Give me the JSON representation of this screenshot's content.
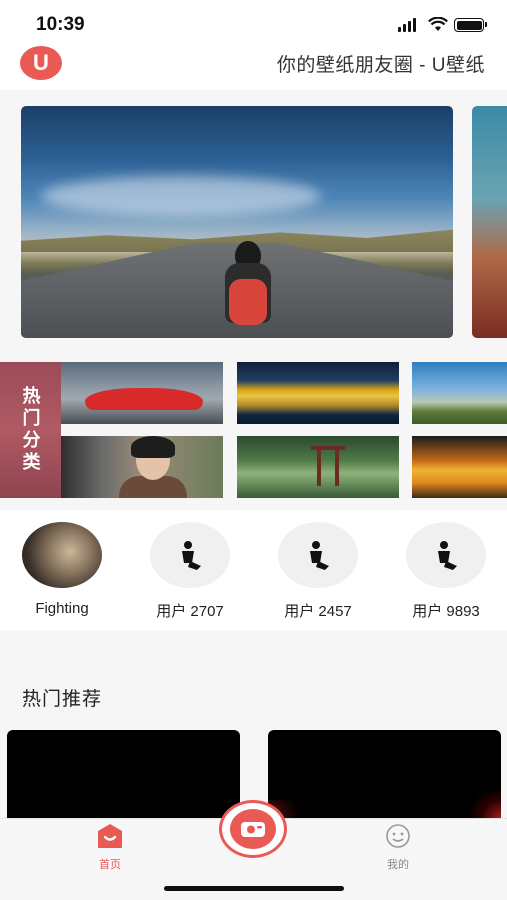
{
  "status_bar": {
    "time": "10:39"
  },
  "header": {
    "logo_letter": "U",
    "title": "你的壁纸朋友圈 - U壁纸"
  },
  "categories": {
    "label": "热门分类"
  },
  "users": [
    {
      "name": "Fighting",
      "has_photo": true
    },
    {
      "name": "用户 2707",
      "has_photo": false
    },
    {
      "name": "用户 2457",
      "has_photo": false
    },
    {
      "name": "用户 9893",
      "has_photo": false
    }
  ],
  "recommend": {
    "title": "热门推荐"
  },
  "tabbar": {
    "home_label": "首页",
    "me_label": "我的"
  },
  "colors": {
    "accent": "#ea5a55",
    "background": "#f6f6f6"
  },
  "icons": {
    "home": "home-icon",
    "camera": "camera-icon",
    "me": "face-icon",
    "user_default": "user-placeholder-icon"
  }
}
